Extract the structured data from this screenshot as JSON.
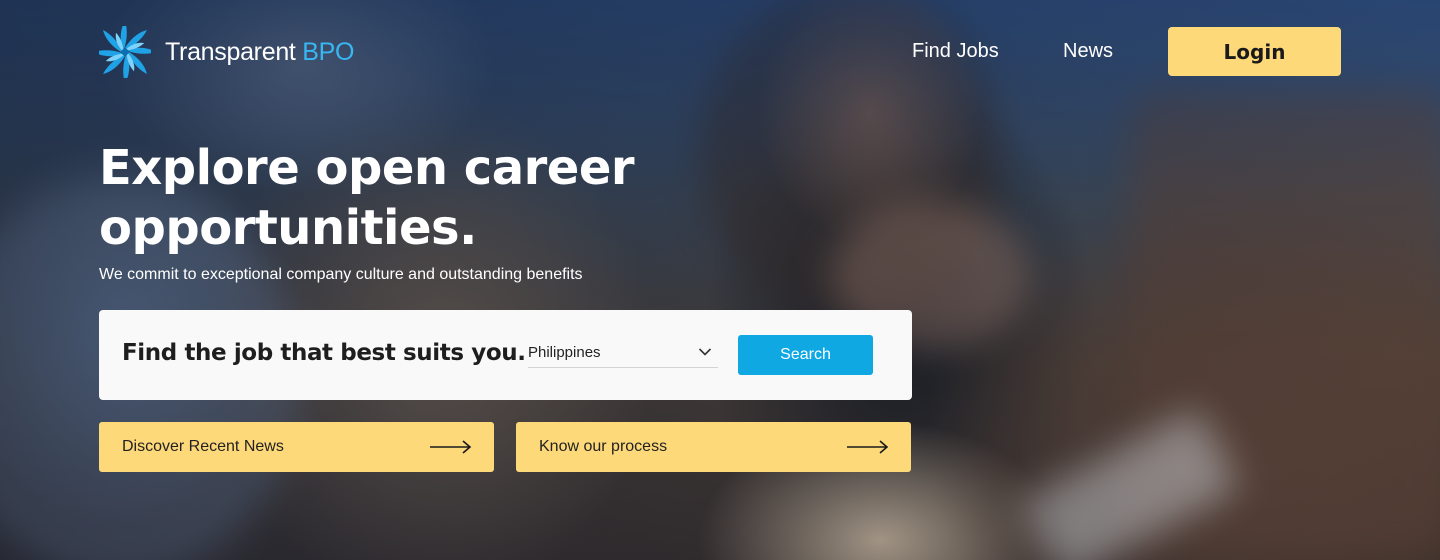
{
  "brand": {
    "name": "Transparent",
    "name_accent": "BPO",
    "logo_icon": "pinwheel-logo-icon",
    "accent_color": "#38b7f2"
  },
  "nav": {
    "links": [
      {
        "label": "Find Jobs"
      },
      {
        "label": "News"
      }
    ],
    "login_label": "Login"
  },
  "hero": {
    "title": "Explore open career opportunities.",
    "subtitle": "We commit to exceptional company culture and outstanding benefits"
  },
  "search": {
    "heading": "Find the job that best suits you.",
    "country_selected": "Philippines",
    "button_label": "Search",
    "button_color": "#0fa8e3"
  },
  "cta": [
    {
      "label": "Discover Recent News",
      "icon": "right-arrow-icon"
    },
    {
      "label": "Know our process",
      "icon": "right-arrow-icon"
    }
  ],
  "colors": {
    "cta_background": "#fed97a",
    "login_background": "#fed97a",
    "card_background": "#f9f9f9"
  }
}
